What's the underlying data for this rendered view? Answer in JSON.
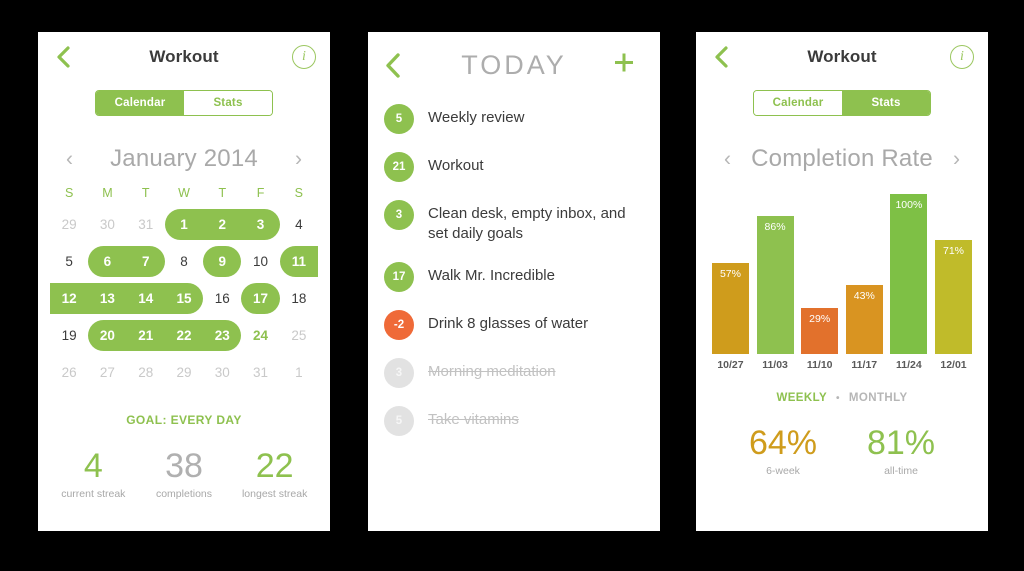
{
  "calendar_screen": {
    "back_icon": "chevron-left-icon",
    "title": "Workout",
    "info_icon": "info-circle-icon",
    "segments": [
      {
        "label": "Calendar",
        "active": true
      },
      {
        "label": "Stats",
        "active": false
      }
    ],
    "month": {
      "prev_icon": "chevron-left-icon",
      "label": "January 2014",
      "next_icon": "chevron-right-icon"
    },
    "weekday_headers": [
      "S",
      "M",
      "T",
      "W",
      "T",
      "F",
      "S"
    ],
    "weeks": [
      [
        {
          "n": "29",
          "state": "muted"
        },
        {
          "n": "30",
          "state": "muted"
        },
        {
          "n": "31",
          "state": "muted"
        },
        {
          "n": "1",
          "state": "on"
        },
        {
          "n": "2",
          "state": "on"
        },
        {
          "n": "3",
          "state": "on"
        },
        {
          "n": "4",
          "state": "plain"
        }
      ],
      [
        {
          "n": "5",
          "state": "plain"
        },
        {
          "n": "6",
          "state": "on"
        },
        {
          "n": "7",
          "state": "on"
        },
        {
          "n": "8",
          "state": "plain"
        },
        {
          "n": "9",
          "state": "on"
        },
        {
          "n": "10",
          "state": "plain"
        },
        {
          "n": "11",
          "state": "on"
        }
      ],
      [
        {
          "n": "12",
          "state": "on"
        },
        {
          "n": "13",
          "state": "on"
        },
        {
          "n": "14",
          "state": "on"
        },
        {
          "n": "15",
          "state": "on"
        },
        {
          "n": "16",
          "state": "plain"
        },
        {
          "n": "17",
          "state": "on"
        },
        {
          "n": "18",
          "state": "plain"
        }
      ],
      [
        {
          "n": "19",
          "state": "plain"
        },
        {
          "n": "20",
          "state": "on"
        },
        {
          "n": "21",
          "state": "on"
        },
        {
          "n": "22",
          "state": "on"
        },
        {
          "n": "23",
          "state": "on"
        },
        {
          "n": "24",
          "state": "today"
        },
        {
          "n": "25",
          "state": "muted"
        }
      ],
      [
        {
          "n": "26",
          "state": "muted"
        },
        {
          "n": "27",
          "state": "muted"
        },
        {
          "n": "28",
          "state": "muted"
        },
        {
          "n": "29",
          "state": "muted"
        },
        {
          "n": "30",
          "state": "muted"
        },
        {
          "n": "31",
          "state": "muted"
        },
        {
          "n": "1",
          "state": "muted"
        }
      ]
    ],
    "highlights": [
      {
        "week": 0,
        "start": 3,
        "end": 5,
        "round": "both"
      },
      {
        "week": 1,
        "start": 1,
        "end": 2,
        "round": "both"
      },
      {
        "week": 1,
        "start": 4,
        "end": 4,
        "round": "both"
      },
      {
        "week": 1,
        "start": 6,
        "end": 6,
        "round": "left"
      },
      {
        "week": 2,
        "start": 0,
        "end": 3,
        "round": "right"
      },
      {
        "week": 2,
        "start": 5,
        "end": 5,
        "round": "both"
      },
      {
        "week": 3,
        "start": 1,
        "end": 4,
        "round": "both"
      }
    ],
    "goal_text": "GOAL: EVERY DAY",
    "streaks": [
      {
        "value": "4",
        "caption": "current streak",
        "color": "green"
      },
      {
        "value": "38",
        "caption": "completions",
        "color": "grey"
      },
      {
        "value": "22",
        "caption": "longest streak",
        "color": "green"
      }
    ]
  },
  "today_screen": {
    "back_icon": "chevron-left-icon",
    "title": "TODAY",
    "add_icon": "plus-icon",
    "tasks": [
      {
        "count": "5",
        "text": "Weekly review",
        "badge": "green",
        "done": false
      },
      {
        "count": "21",
        "text": "Workout",
        "badge": "green",
        "done": false
      },
      {
        "count": "3",
        "text": "Clean desk, empty inbox, and set daily goals",
        "badge": "green",
        "done": false
      },
      {
        "count": "17",
        "text": "Walk Mr. Incredible",
        "badge": "green",
        "done": false
      },
      {
        "count": "-2",
        "text": "Drink 8 glasses of water",
        "badge": "red",
        "done": false
      },
      {
        "count": "3",
        "text": "Morning meditation",
        "badge": "done",
        "done": true
      },
      {
        "count": "5",
        "text": "Take vitamins",
        "badge": "done",
        "done": true
      }
    ]
  },
  "stats_screen": {
    "back_icon": "chevron-left-icon",
    "title": "Workout",
    "info_icon": "info-circle-icon",
    "segments": [
      {
        "label": "Calendar",
        "active": false
      },
      {
        "label": "Stats",
        "active": true
      }
    ],
    "metric": {
      "prev_icon": "chevron-left-icon",
      "label": "Completion Rate",
      "next_icon": "chevron-right-icon"
    },
    "period_toggle": {
      "weekly_label": "WEEKLY",
      "separator": "•",
      "monthly_label": "MONTHLY",
      "selected": "WEEKLY"
    },
    "rates": [
      {
        "value": "64%",
        "caption": "6-week",
        "color": "#cf9c1c"
      },
      {
        "value": "81%",
        "caption": "all-time",
        "color": "#8ec14f"
      }
    ]
  },
  "chart_data": {
    "type": "bar",
    "title": "Completion Rate",
    "xlabel": "",
    "ylabel": "",
    "ylim": [
      0,
      100
    ],
    "grid": false,
    "legend": "none",
    "categories": [
      "10/27",
      "11/03",
      "11/10",
      "11/17",
      "11/24",
      "12/01"
    ],
    "values": [
      57,
      86,
      29,
      43,
      100,
      71
    ],
    "labels": [
      "57%",
      "86%",
      "29%",
      "43%",
      "100%",
      "71%"
    ],
    "colors": [
      "#cf9c1c",
      "#8ec14f",
      "#e2712c",
      "#d99421",
      "#7ec045",
      "#c0bb2a"
    ]
  },
  "theme": {
    "accent_green": "#8ec14f",
    "red": "#ef6a38",
    "page_background": "#000000",
    "card_background": "#ffffff"
  }
}
